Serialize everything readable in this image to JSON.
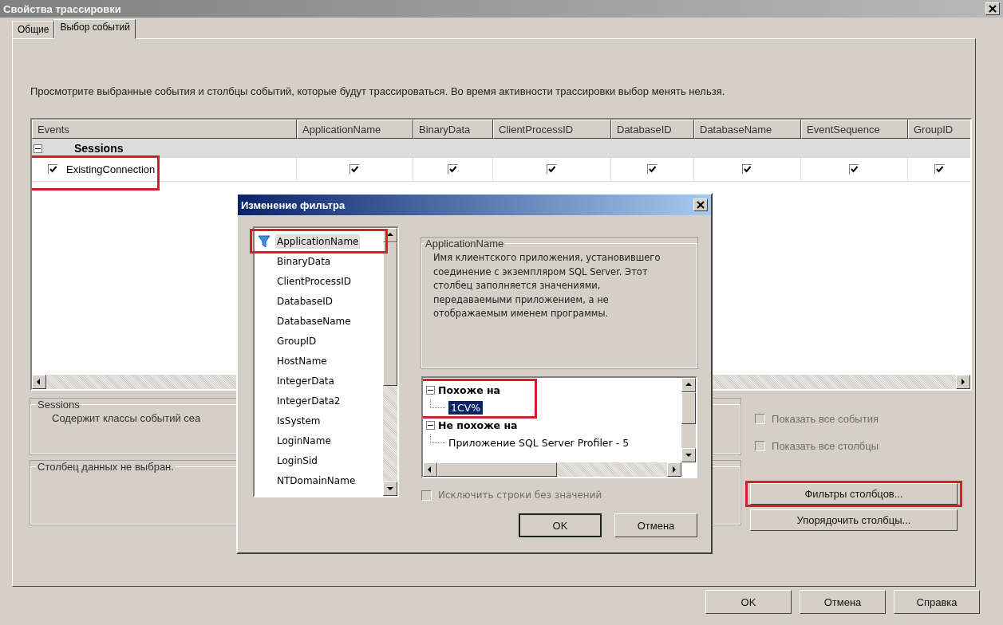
{
  "window": {
    "title": "Свойства трассировки"
  },
  "tabs": [
    {
      "label": "Общие",
      "selected": false
    },
    {
      "label": "Выбор событий",
      "selected": true
    }
  ],
  "description": "Просмотрите выбранные события и столбцы событий, которые будут трассироваться. Во время активности трассировки выбор менять нельзя.",
  "grid": {
    "columns": [
      "Events",
      "ApplicationName",
      "BinaryData",
      "ClientProcessID",
      "DatabaseID",
      "DatabaseName",
      "EventSequence",
      "GroupID"
    ],
    "rows": [
      {
        "kind": "category",
        "label": "Sessions",
        "expanded": true
      },
      {
        "kind": "event",
        "label": "ExistingConnection",
        "checked": true,
        "highlighted": true,
        "cells": [
          {
            "checked": true
          },
          {
            "checked": true
          },
          {
            "checked": true
          },
          {
            "checked": true
          },
          {
            "checked": true
          },
          {
            "checked": true
          },
          {
            "checked": true
          }
        ]
      }
    ]
  },
  "event_group": {
    "title": "Sessions",
    "text": "Содержит классы событий сеа"
  },
  "column_group": {
    "title": "Столбец данных не выбран."
  },
  "options": [
    {
      "label": "Показать все события",
      "checked": false,
      "disabled": true
    },
    {
      "label": "Показать все столбцы",
      "checked": false,
      "disabled": true
    }
  ],
  "side_buttons": [
    {
      "label": "Фильтры столбцов...",
      "highlighted": true
    },
    {
      "label": "Упорядочить столбцы...",
      "highlighted": false
    }
  ],
  "footer_buttons": [
    "OK",
    "Отмена",
    "Справка"
  ],
  "filter_dialog": {
    "title": "Изменение фильтра",
    "columns": [
      {
        "label": "ApplicationName",
        "selected": true,
        "filtered": true,
        "highlighted": true
      },
      {
        "label": "BinaryData",
        "selected": false,
        "filtered": false,
        "highlighted": false
      },
      {
        "label": "ClientProcessID",
        "selected": false,
        "filtered": false,
        "highlighted": false
      },
      {
        "label": "DatabaseID",
        "selected": false,
        "filtered": false,
        "highlighted": false
      },
      {
        "label": "DatabaseName",
        "selected": false,
        "filtered": false,
        "highlighted": false
      },
      {
        "label": "GroupID",
        "selected": false,
        "filtered": false,
        "highlighted": false
      },
      {
        "label": "HostName",
        "selected": false,
        "filtered": false,
        "highlighted": false
      },
      {
        "label": "IntegerData",
        "selected": false,
        "filtered": false,
        "highlighted": false
      },
      {
        "label": "IntegerData2",
        "selected": false,
        "filtered": false,
        "highlighted": false
      },
      {
        "label": "IsSystem",
        "selected": false,
        "filtered": false,
        "highlighted": false
      },
      {
        "label": "LoginName",
        "selected": false,
        "filtered": false,
        "highlighted": false
      },
      {
        "label": "LoginSid",
        "selected": false,
        "filtered": false,
        "highlighted": false
      },
      {
        "label": "NTDomainName",
        "selected": false,
        "filtered": false,
        "highlighted": false
      }
    ],
    "info": {
      "title": "ApplicationName",
      "text": "Имя клиентского приложения, установившего соединение с экземпляром SQL Server. Этот столбец заполняется значениями, передаваемыми приложением, а не отображаемым именем программы."
    },
    "conditions": [
      {
        "label": "Похоже на",
        "expanded": true,
        "highlighted": true,
        "children": [
          {
            "label": "1CV%",
            "selected": true
          }
        ]
      },
      {
        "label": "Не похоже на",
        "expanded": true,
        "highlighted": false,
        "children": [
          {
            "label": "Приложение SQL Server Profiler - 5",
            "selected": false
          }
        ]
      }
    ],
    "exclude": {
      "label": "Исключить строки без значений",
      "checked": false,
      "disabled": true
    },
    "buttons": [
      {
        "label": "OK",
        "default": true
      },
      {
        "label": "Отмена",
        "default": false
      }
    ]
  }
}
